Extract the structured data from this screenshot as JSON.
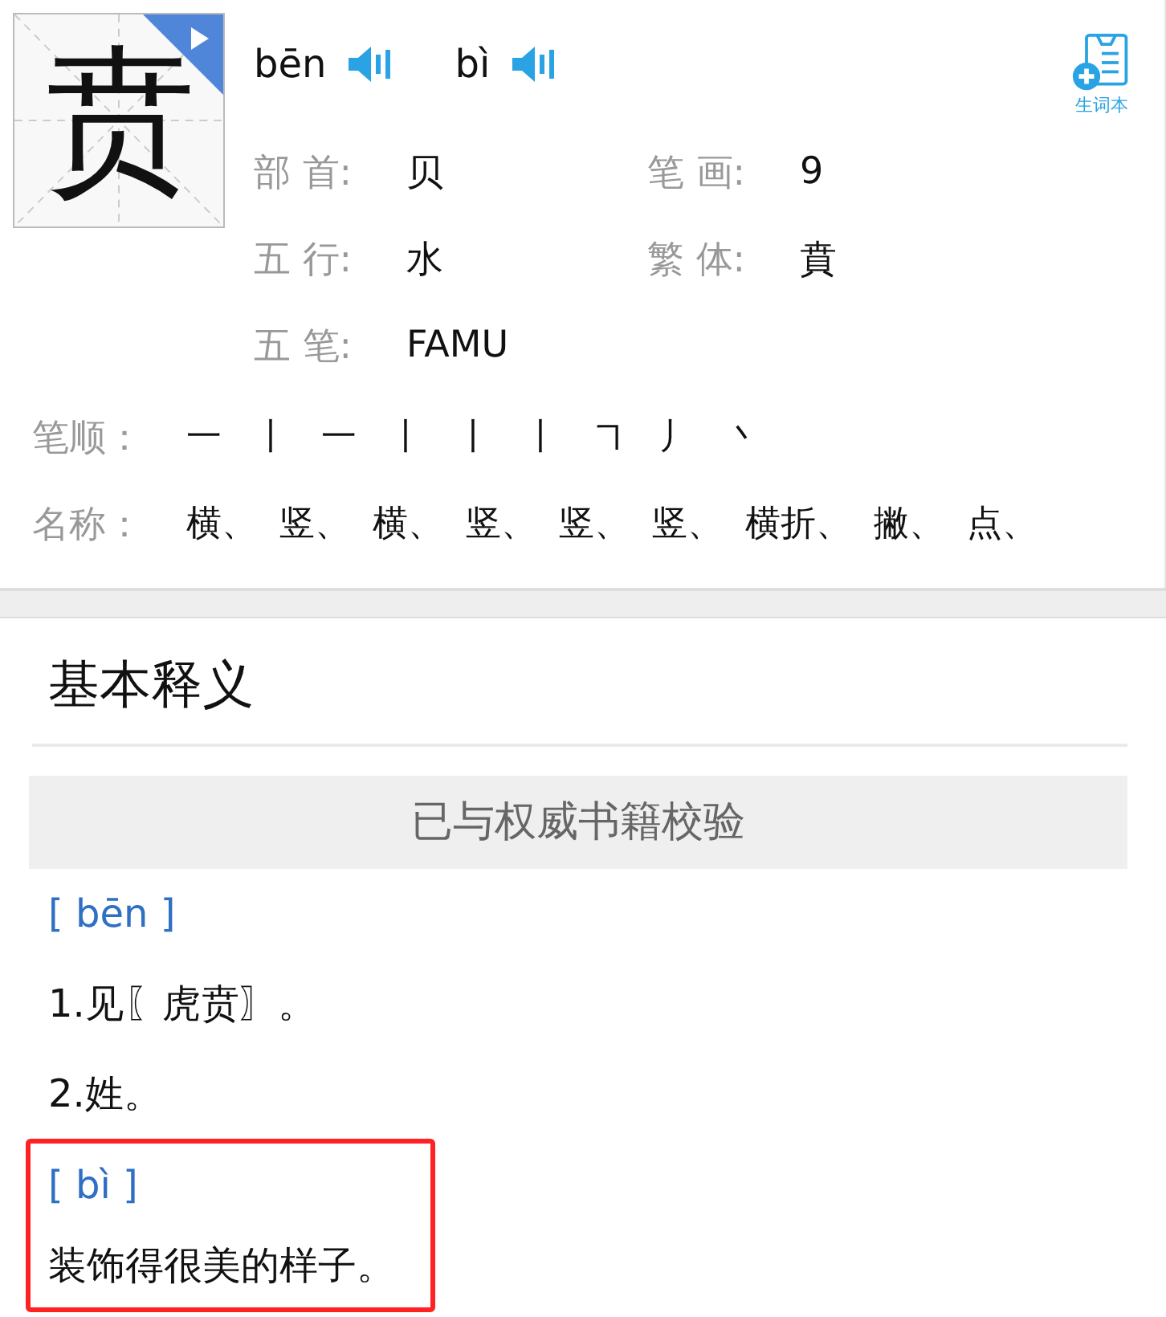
{
  "character": {
    "glyph": "贲"
  },
  "pronunciations": [
    {
      "pinyin": "bēn"
    },
    {
      "pinyin": "bì"
    }
  ],
  "wordbook_button": {
    "label": "生词本"
  },
  "info": [
    {
      "label": "部 首:",
      "value": "贝"
    },
    {
      "label": "笔 画:",
      "value": "9"
    },
    {
      "label": "五 行:",
      "value": "水"
    },
    {
      "label": "繁 体:",
      "value": "賁"
    },
    {
      "label": "五 笔:",
      "value": "FAMU"
    }
  ],
  "stroke_order": {
    "label": "笔顺：",
    "items": [
      "一",
      "丨",
      "一",
      "丨",
      "丨",
      "丨",
      "㇕",
      "丿",
      "丶"
    ]
  },
  "stroke_names": {
    "label": "名称：",
    "items": [
      "横、",
      "竖、",
      "横、",
      "竖、",
      "竖、",
      "竖、",
      "横折、",
      "撇、",
      "点、"
    ]
  },
  "section_title": "基本释义",
  "verified_banner": "已与权威书籍校验",
  "readings": [
    {
      "pinyin": "[ bēn ]",
      "highlighted": false,
      "definitions": [
        "1.见〖虎贲〗。",
        "2.姓。"
      ]
    },
    {
      "pinyin": "[ bì ]",
      "highlighted": true,
      "definitions": [
        "装饰得很美的样子。"
      ]
    }
  ]
}
